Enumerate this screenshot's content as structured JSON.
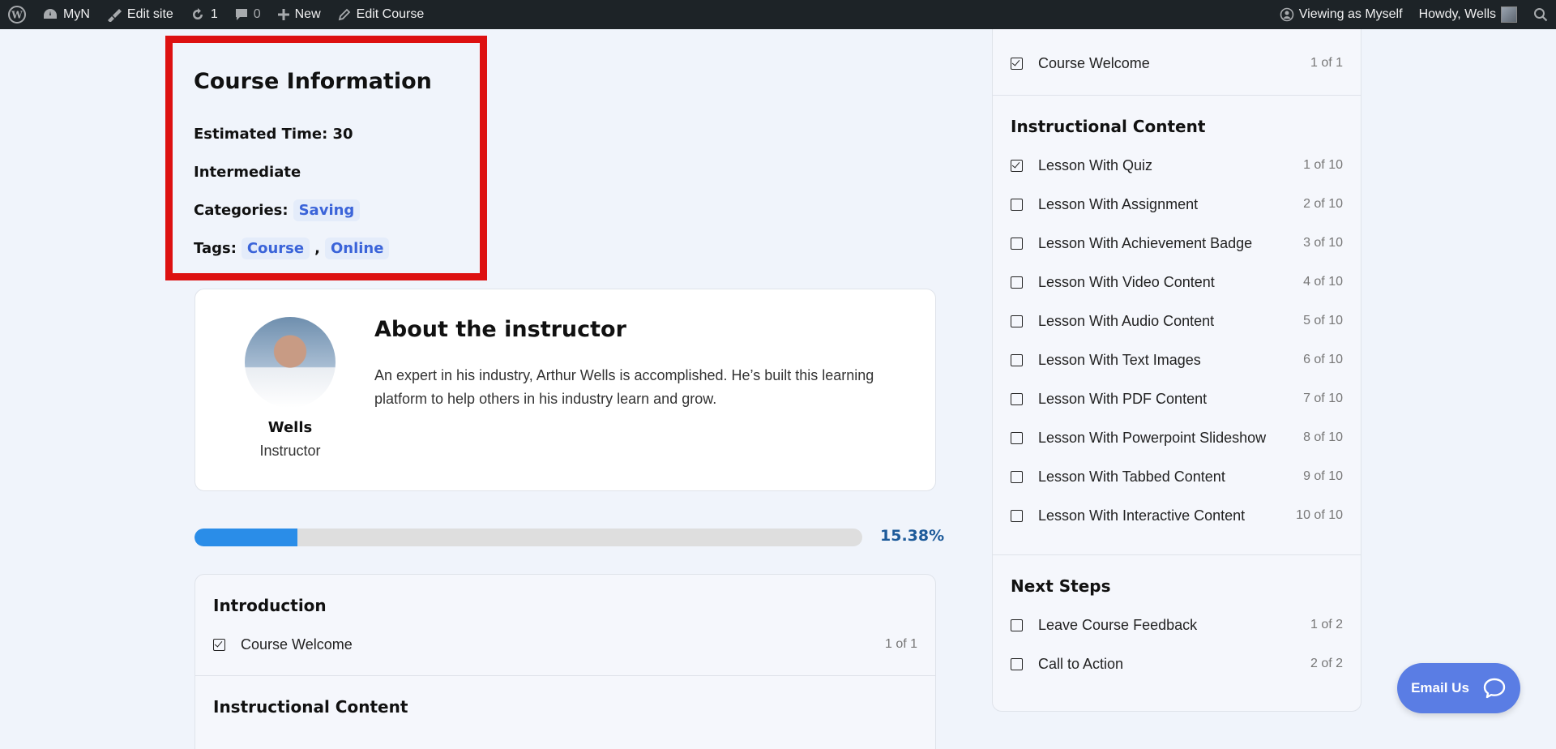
{
  "adminbar": {
    "site_name": "MyN",
    "edit_site": "Edit site",
    "updates_count": "1",
    "comments_count": "0",
    "new_label": "New",
    "edit_course": "Edit Course",
    "viewing_as": "Viewing as Myself",
    "howdy": "Howdy, Wells"
  },
  "course_info": {
    "title": "Course Information",
    "estimated_time": "Estimated Time: 30",
    "level": "Intermediate",
    "categories_label": "Categories:",
    "categories": [
      "Saving"
    ],
    "tags_label": "Tags:",
    "tags": [
      "Course",
      "Online"
    ],
    "tag_separator": ","
  },
  "instructor": {
    "heading": "About the instructor",
    "bio": "An expert in his industry, Arthur Wells is accomplished. He’s built this learning platform to help others in his industry learn and grow.",
    "name": "Wells",
    "role": "Instructor"
  },
  "progress": {
    "percent_label": "15.38%",
    "fraction": 0.1538
  },
  "outline_left": {
    "sections": [
      {
        "title": "Introduction",
        "items": [
          {
            "label": "Course Welcome",
            "count": "1 of 1",
            "checked": true
          }
        ]
      },
      {
        "title": "Instructional Content",
        "items": []
      }
    ]
  },
  "outline_right": {
    "top_item": {
      "label": "Course Welcome",
      "count": "1 of 1",
      "checked": true
    },
    "sections": [
      {
        "title": "Instructional Content",
        "items": [
          {
            "label": "Lesson With Quiz",
            "count": "1 of 10",
            "checked": true
          },
          {
            "label": "Lesson With Assignment",
            "count": "2 of 10",
            "checked": false
          },
          {
            "label": "Lesson With Achievement Badge",
            "count": "3 of 10",
            "checked": false
          },
          {
            "label": "Lesson With Video Content",
            "count": "4 of 10",
            "checked": false
          },
          {
            "label": "Lesson With Audio Content",
            "count": "5 of 10",
            "checked": false
          },
          {
            "label": "Lesson With Text Images",
            "count": "6 of 10",
            "checked": false
          },
          {
            "label": "Lesson With PDF Content",
            "count": "7 of 10",
            "checked": false
          },
          {
            "label": "Lesson With Powerpoint Slideshow",
            "count": "8 of 10",
            "checked": false
          },
          {
            "label": "Lesson With Tabbed Content",
            "count": "9 of 10",
            "checked": false
          },
          {
            "label": "Lesson With Interactive Content",
            "count": "10 of 10",
            "checked": false
          }
        ]
      },
      {
        "title": "Next Steps",
        "items": [
          {
            "label": "Leave Course Feedback",
            "count": "1 of 2",
            "checked": false
          },
          {
            "label": "Call to Action",
            "count": "2 of 2",
            "checked": false
          }
        ]
      }
    ]
  },
  "email_button": {
    "label": "Email Us"
  },
  "colors": {
    "accent": "#2a8de8",
    "highlight_border": "#dd1111",
    "tag_text": "#3b64d9"
  }
}
